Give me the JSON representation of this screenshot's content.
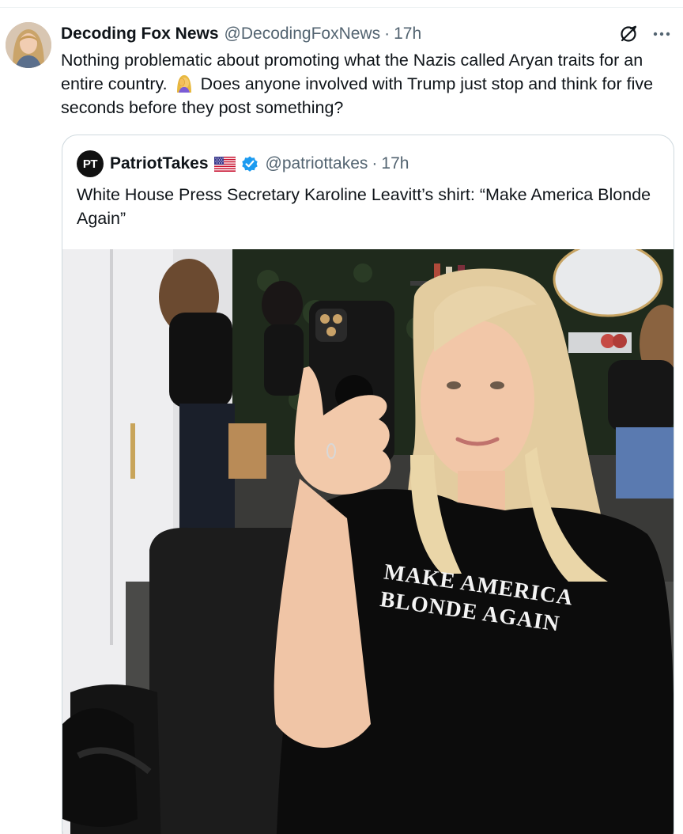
{
  "post": {
    "display_name": "Decoding Fox News",
    "handle": "@DecodingFoxNews",
    "separator": "·",
    "time": "17h",
    "text_part1": "Nothing problematic about promoting what the Nazis called Aryan traits for an entire country.",
    "emoji_icon": "woman-facepalming-icon",
    "text_part2": "Does anyone involved with Trump just stop and think for five seconds before they post something?",
    "actions": {
      "grok_icon": "grok-icon",
      "more_icon": "more-icon"
    }
  },
  "quote": {
    "avatar_initials": "PT",
    "display_name": "PatriotTakes",
    "flag_icon": "us-flag-icon",
    "verified_icon": "verified-badge-icon",
    "handle": "@patriottakes",
    "separator": "·",
    "time": "17h",
    "text": "White House Press Secretary Karoline Leavitt’s shirt: “Make America Blonde Again”",
    "photo": {
      "shirt_line1": "MAKE AMERICA",
      "shirt_line2": "BLONDE AGAIN"
    }
  },
  "colors": {
    "text": "#0f1419",
    "secondary": "#536471",
    "border": "#cfd9de",
    "verified": "#1d9bf0"
  }
}
